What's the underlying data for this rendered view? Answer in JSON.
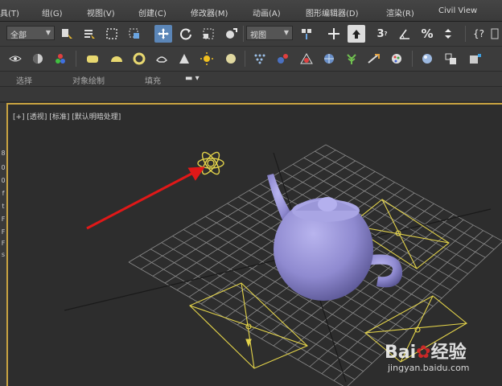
{
  "menu": {
    "items": [
      "具(T)",
      "组(G)",
      "视图(V)",
      "创建(C)",
      "修改器(M)",
      "动画(A)",
      "图形编辑器(D)",
      "渲染(R)",
      "Civil View"
    ]
  },
  "toolbar1": {
    "selection_filter": "全部",
    "reference_coord": "视图",
    "icons": [
      "select-object-icon",
      "select-by-name-icon",
      "rectangular-selection-icon",
      "window-crossing-icon",
      "select-and-move-icon",
      "select-and-rotate-icon",
      "select-and-scale-icon",
      "select-and-place-icon",
      "use-pivot-center-icon",
      "select-manipulate-icon",
      "keyboard-shortcut-icon",
      "snaps-toggle-icon",
      "angle-snap-icon",
      "percent-snap-icon",
      "spinner-snap-icon",
      "named-selection-icon"
    ]
  },
  "toolbar2": {
    "icons": [
      "render-setup-icon",
      "material-editor-icon",
      "render-frame-icon",
      "standard-primitives-icon",
      "sphere-icon",
      "torus-icon",
      "teapot-icon",
      "cone-icon",
      "sun-light-icon",
      "sky-icon",
      "particle-icon",
      "physical-camera-icon",
      "shape-icon",
      "geosphere-icon",
      "foliage-icon",
      "helper-icon",
      "render-icon",
      "light-icon",
      "camera-icon",
      "space-warp-icon"
    ]
  },
  "ribbon": {
    "tabs": [
      "选择",
      "对象绘制",
      "填充"
    ]
  },
  "viewport": {
    "label": "[+] [透视] [标准] [默认明暗处理]"
  },
  "left_strip": {
    "glyphs": [
      "8",
      "0",
      "0",
      "f",
      "t",
      "F",
      "F",
      "F",
      "s"
    ]
  },
  "watermark": {
    "logo_prefix": "Bai",
    "logo_suffix": "经验",
    "url": "jingyan.baidu.com"
  },
  "colors": {
    "viewport_bg": "#2d2d2d",
    "grid": "#8a8a8a",
    "selection": "#e3d34a",
    "teapot": "#8f8ad0",
    "arrow": "#e01818",
    "active_border": "#c9a341"
  }
}
